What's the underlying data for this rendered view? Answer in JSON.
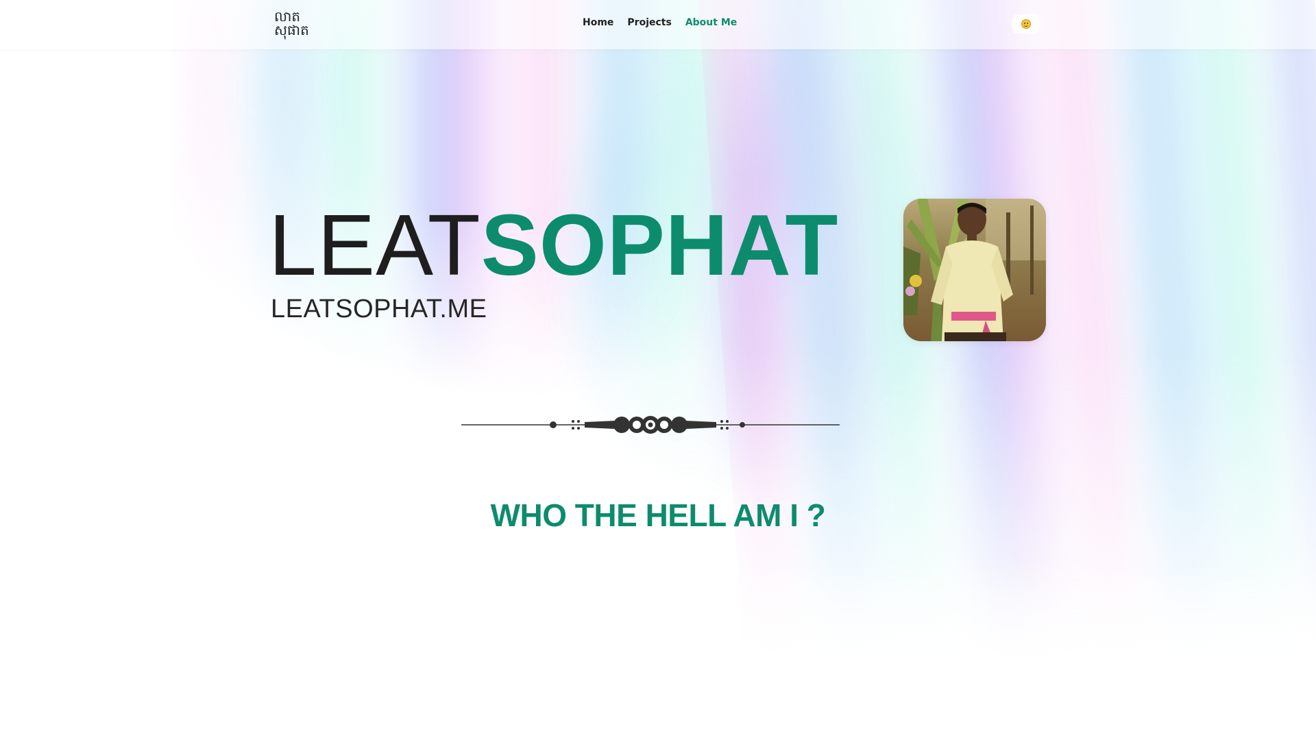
{
  "header": {
    "logo_line1": "លាត",
    "logo_line2": "សុផាត",
    "nav": [
      {
        "label": "Home",
        "active": false
      },
      {
        "label": "Projects",
        "active": false
      },
      {
        "label": "About Me",
        "active": true
      }
    ],
    "theme_toggle_icon": "smiley-face-icon"
  },
  "hero": {
    "name_part1": "LEAT",
    "name_part2": "SOPHAT",
    "domain": "LEATSOPHAT.ME",
    "photo": "profile-photo"
  },
  "section": {
    "heading": "WHO THE HELL AM I ?"
  },
  "colors": {
    "accent": "#0d8c6d",
    "text": "#1e1e1e",
    "background": "#ffffff"
  }
}
